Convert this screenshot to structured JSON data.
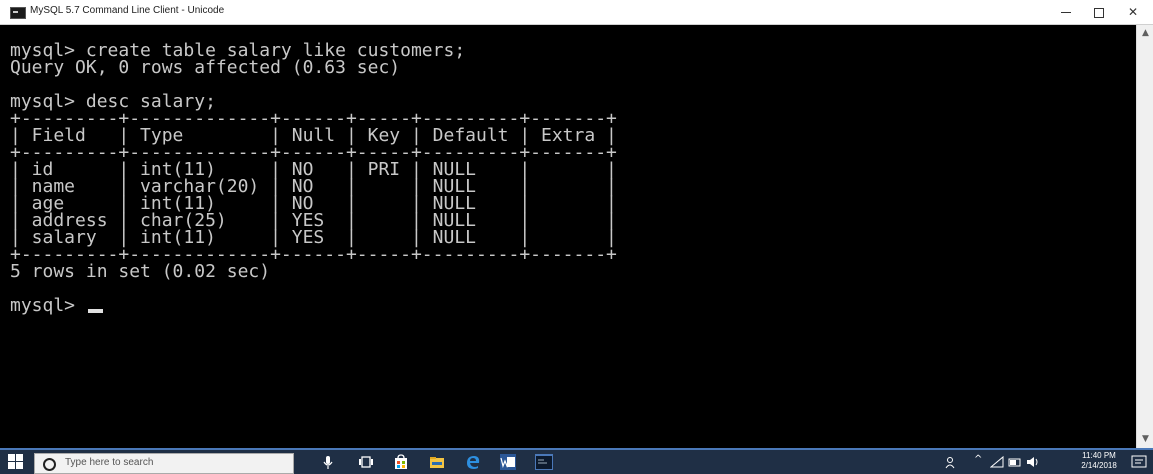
{
  "window": {
    "title": "MySQL 5.7 Command Line Client - Unicode",
    "min_glyph": "—",
    "max_glyph": "☐",
    "close_glyph": "✕"
  },
  "console": {
    "text": "mysql> create table salary like customers;\nQuery OK, 0 rows affected (0.63 sec)\n\nmysql> desc salary;\n+---------+-------------+------+-----+---------+-------+\n| Field   | Type        | Null | Key | Default | Extra |\n+---------+-------------+------+-----+---------+-------+\n| id      | int(11)     | NO   | PRI | NULL    |       |\n| name    | varchar(20) | NO   |     | NULL    |       |\n| age     | int(11)     | NO   |     | NULL    |       |\n| address | char(25)    | YES  |     | NULL    |       |\n| salary  | int(11)     | YES  |     | NULL    |       |\n+---------+-------------+------+-----+---------+-------+\n5 rows in set (0.02 sec)\n\nmysql> "
  },
  "scrollbar": {
    "up_glyph": "▲",
    "down_glyph": "▼"
  },
  "taskbar": {
    "search_placeholder": "Type here to search",
    "clock_time": "11:40 PM",
    "clock_date": "2/14/2018",
    "tray_glyphs": "^"
  },
  "colors": {
    "console_bg": "#000000",
    "console_fg": "#c8c8c8",
    "taskbar_bg": "#1f2f45",
    "accent": "#4a78b8"
  },
  "icons": [
    "app-console-icon",
    "minimize-icon",
    "maximize-icon",
    "close-icon",
    "windows-start-icon",
    "search-icon",
    "microphone-icon",
    "task-view-icon",
    "store-icon",
    "file-explorer-icon",
    "edge-icon",
    "word-icon",
    "console-taskbar-icon",
    "network-icon",
    "volume-icon",
    "notification-icon"
  ]
}
